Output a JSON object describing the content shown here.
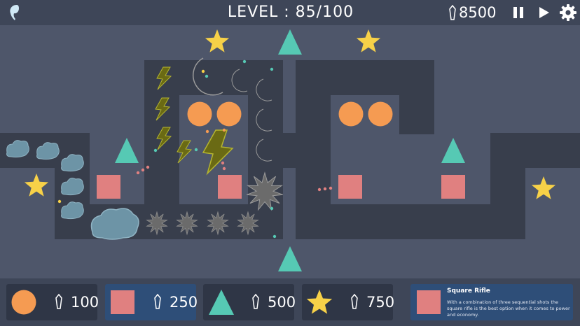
{
  "header": {
    "level_label": "LEVEL : 85/100",
    "money": "8500",
    "pause_icon": "pause-icon",
    "play_icon": "play-icon",
    "settings_icon": "gear-icon",
    "menu_icon": "leaf-icon"
  },
  "shop": {
    "items": [
      {
        "tower": "circle",
        "cost": "100",
        "color": "#f59b52"
      },
      {
        "tower": "square",
        "cost": "250",
        "color": "#e08080"
      },
      {
        "tower": "triangle",
        "cost": "500",
        "color": "#56c9b4"
      },
      {
        "tower": "star",
        "cost": "750",
        "color": "#f7d148"
      }
    ],
    "selected_index": 1
  },
  "info": {
    "title": "Square Rifle",
    "description": "With a combination of three sequential shots the square rifle is the best option when it comes to power and economy."
  },
  "colors": {
    "background": "#4e566a",
    "path": "#383e4c",
    "bar": "#3e4658",
    "accent": "#2e4e78",
    "circle": "#f59b52",
    "square": "#e08080",
    "triangle": "#56c9b4",
    "star": "#f7d148",
    "moon": "#dddddd",
    "lightning": "#6a6a14",
    "cloud": "#6d94a6",
    "spike": "#6b6b6b"
  }
}
